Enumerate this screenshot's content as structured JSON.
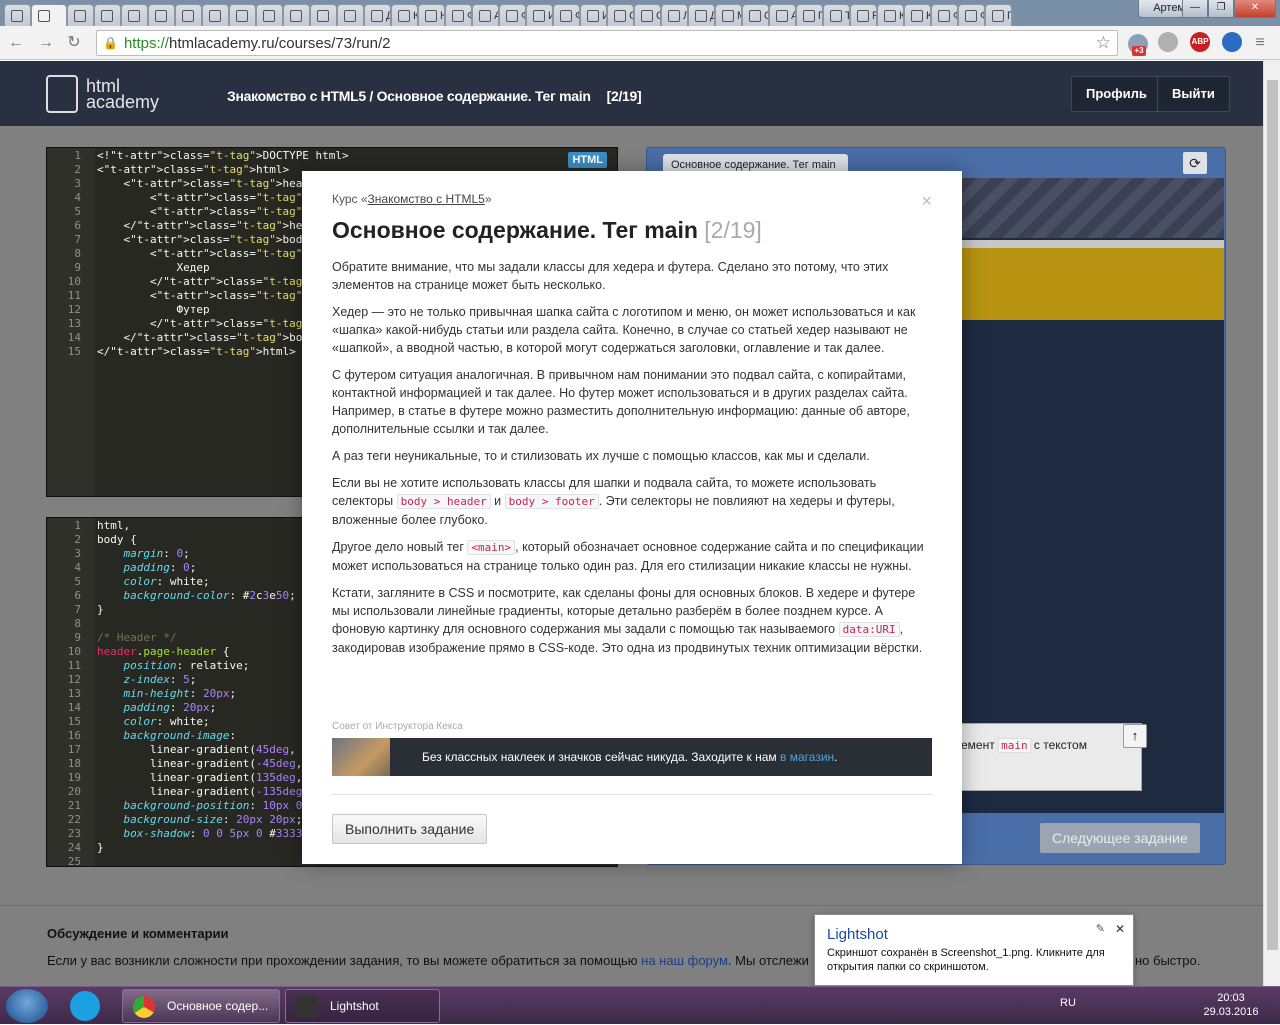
{
  "browser": {
    "tabs": [
      "",
      "",
      "",
      "",
      "",
      "",
      "",
      "",
      "",
      "",
      "",
      "",
      "",
      "Да",
      "Ка",
      "Ни",
      "Фс",
      "Ау",
      "Фс",
      "Ис",
      "Фс",
      "Иг",
      "Се",
      "Се",
      "Ли",
      "Де",
      "Ма",
      "Ос",
      "Ан",
      "Пл",
      "Та",
      "Ра",
      "Ке",
      "Ке",
      "Фл",
      "Фл",
      "Пр"
    ],
    "user": "Артем",
    "url_proto": "https://",
    "url_rest": "htmlacademy.ru/courses/73/run/2",
    "ext_badge": "+3",
    "abp": "ABP"
  },
  "site": {
    "logo_line1": "html",
    "logo_line2": "academy",
    "breadcrumb": "Знакомство с HTML5 / Основное содержание. Тег main",
    "step": "[2/19]",
    "profile_btn": "Профиль",
    "logout_btn": "Выйти"
  },
  "html_editor": {
    "badge": "HTML",
    "lines": [
      {
        "n": "1",
        "code": "<!DOCTYPE html>"
      },
      {
        "n": "2",
        "code": "<html>"
      },
      {
        "n": "3",
        "code": "    <head>"
      },
      {
        "n": "4",
        "code": "        <title>Основное содержан"
      },
      {
        "n": "5",
        "code": "        <meta charset=\"utf-8\">"
      },
      {
        "n": "6",
        "code": "    </head>"
      },
      {
        "n": "7",
        "code": "    <body>"
      },
      {
        "n": "8",
        "code": "        <header class=\"page-hea"
      },
      {
        "n": "9",
        "code": "            Хедер"
      },
      {
        "n": "10",
        "code": "        </header>"
      },
      {
        "n": "11",
        "code": "        <footer class=\"page-foo"
      },
      {
        "n": "12",
        "code": "            Футер"
      },
      {
        "n": "13",
        "code": "        </footer>"
      },
      {
        "n": "14",
        "code": "    </body>"
      },
      {
        "n": "15",
        "code": "</html>"
      }
    ]
  },
  "css_editor": {
    "lines": [
      {
        "n": "1",
        "code": "html,"
      },
      {
        "n": "2",
        "code": "body {"
      },
      {
        "n": "3",
        "code": "    margin: 0;"
      },
      {
        "n": "4",
        "code": "    padding: 0;"
      },
      {
        "n": "5",
        "code": "    color: white;"
      },
      {
        "n": "6",
        "code": "    background-color: #2c3e50;"
      },
      {
        "n": "7",
        "code": "}"
      },
      {
        "n": "8",
        "code": ""
      },
      {
        "n": "9",
        "code": "/* Header */"
      },
      {
        "n": "10",
        "code": "header.page-header {"
      },
      {
        "n": "11",
        "code": "    position: relative;"
      },
      {
        "n": "12",
        "code": "    z-index: 5;"
      },
      {
        "n": "13",
        "code": "    min-height: 20px;"
      },
      {
        "n": "14",
        "code": "    padding: 20px;"
      },
      {
        "n": "15",
        "code": "    color: white;"
      },
      {
        "n": "16",
        "code": "    background-image:"
      },
      {
        "n": "17",
        "code": "        linear-gradient(45deg,"
      },
      {
        "n": "18",
        "code": "        linear-gradient(-45deg,"
      },
      {
        "n": "19",
        "code": "        linear-gradient(135deg,"
      },
      {
        "n": "20",
        "code": "        linear-gradient(-135deg"
      },
      {
        "n": "21",
        "code": "    background-position: 10px 0"
      },
      {
        "n": "22",
        "code": "    background-size: 20px 20px;"
      },
      {
        "n": "23",
        "code": "    box-shadow: 0 0 5px 0 #3333"
      },
      {
        "n": "24",
        "code": "}"
      },
      {
        "n": "25",
        "code": ""
      }
    ]
  },
  "preview": {
    "tab": "Основное содержание. Тег main —",
    "main_text_a": "емент",
    "main_code": "main",
    "main_text_b": "с текстом",
    "next_btn": "Следующее задание"
  },
  "modal": {
    "course_prefix": "Курс «",
    "course_link": "Знакомство с HTML5",
    "course_suffix": "»",
    "title": "Основное содержание. Тег main",
    "count": "[2/19]",
    "p1": "Обратите внимание, что мы задали классы для хедера и футера. Сделано это потому, что этих элементов на странице может быть несколько.",
    "p2": "Хедер — это не только привычная шапка сайта с логотипом и меню, он может использоваться и как «шапка» какой-нибудь статьи или раздела сайта. Конечно, в случае со статьей хедер называют не «шапкой», а вводной частью, в которой могут содержаться заголовки, оглавление и так далее.",
    "p3": "С футером ситуация аналогичная. В привычном нам понимании это подвал сайта, с копирайтами, контактной информацией и так далее. Но футер может использоваться и в других разделах сайта. Например, в статье в футере можно разместить дополнительную информацию: данные об авторе, дополнительные ссылки и так далее.",
    "p4": "А раз теги неуникальные, то и стилизовать их лучше с помощью классов, как мы и сделали.",
    "p5a": "Если вы не хотите использовать классы для шапки и подвала сайта, то можете использовать селекторы ",
    "p5code1": "body > header",
    "p5b": " и ",
    "p5code2": "body > footer",
    "p5c": ". Эти селекторы не повлияют на хедеры и футеры, вложенные более глубоко.",
    "p6a": "Другое дело новый тег ",
    "p6code": "<main>",
    "p6b": ", который обозначает основное содержание сайта и по спецификации может использоваться на странице только один раз. Для его стилизации никакие классы не нужны.",
    "p7a": "Кстати, загляните в CSS и посмотрите, как сделаны фоны для основных блоков. В хедере и футере мы использовали линейные градиенты, которые детально разберём в более позднем курсе. А фоновую картинку для основного содержания мы задали с помощью так называемого ",
    "p7code": "data:URI",
    "p7b": ", закодировав изображение прямо в CSS-коде. Это одна из продвинутых техник оптимизации вёрстки.",
    "tip_label": "Совет от Инструктора Кекса",
    "tip_text": "Без классных наклеек и значков сейчас никуда. Заходите к нам ",
    "tip_link": "в магазин",
    "tip_end": ".",
    "do_btn": "Выполнить задание",
    "close": "×"
  },
  "discussion": {
    "title": "Обсуждение и комментарии",
    "text_a": "Если у вас возникли сложности при прохождении задания, то вы можете обратиться за помощью ",
    "link": "на наш форум",
    "text_b": ". Мы отслежи",
    "tail": "но быстро."
  },
  "notification": {
    "title": "Lightshot",
    "message": "Скриншот сохранён в Screenshot_1.png. Кликните для открытия папки со скриншотом."
  },
  "taskbar": {
    "task1": "Основное содер...",
    "task2": "Lightshot",
    "lang": "RU",
    "time": "20:03",
    "date": "29.03.2016"
  }
}
